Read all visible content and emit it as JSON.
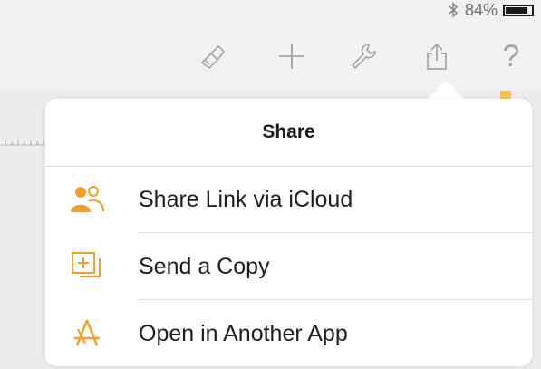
{
  "status": {
    "battery_text": "84%",
    "battery_level": 0.84
  },
  "toolbar": {
    "items": [
      "paintbrush-icon",
      "plus-icon",
      "wrench-icon",
      "share-icon",
      "help-icon"
    ],
    "help_label": "?"
  },
  "popover": {
    "title": "Share",
    "items": [
      {
        "label": "Share Link via iCloud",
        "icon": "people-icon"
      },
      {
        "label": "Send a Copy",
        "icon": "copy-icon"
      },
      {
        "label": "Open in Another App",
        "icon": "app-store-icon"
      }
    ]
  },
  "colors": {
    "accent": "#f0a02c",
    "toolbar_icon": "#a5a5a8"
  }
}
